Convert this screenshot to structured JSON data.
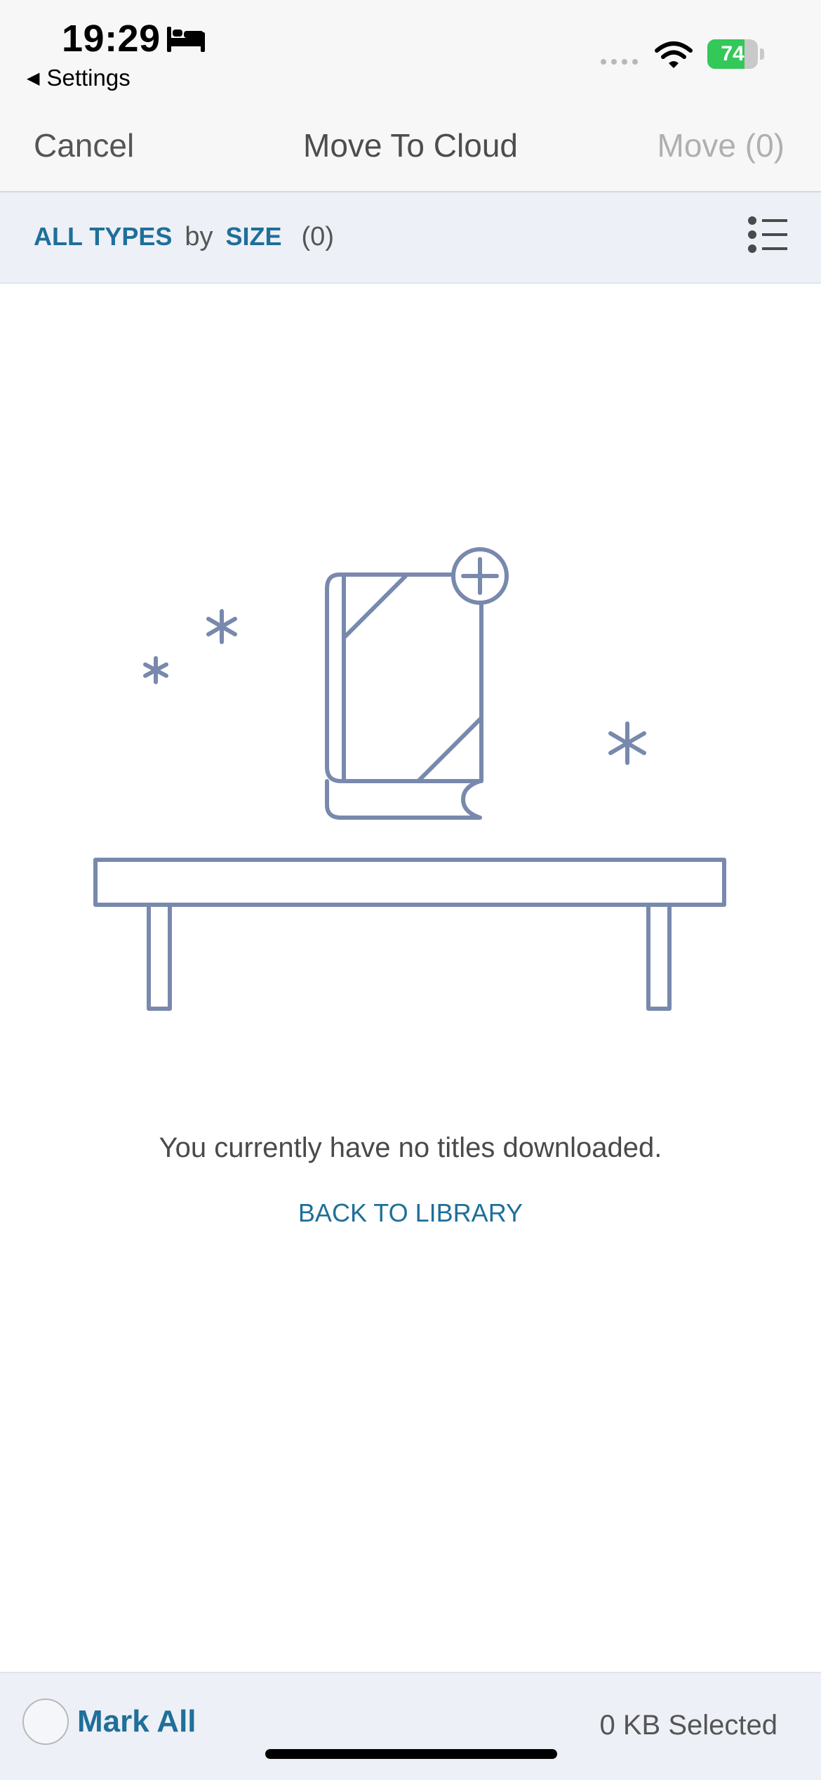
{
  "status_bar": {
    "time": "19:29",
    "back_label": "Settings",
    "battery_percent": 74,
    "battery_label": "74",
    "battery_color": "#34c759",
    "icons": [
      "bed-icon",
      "cellular-signal-icon",
      "wifi-icon",
      "battery-charging-icon"
    ]
  },
  "nav": {
    "cancel_label": "Cancel",
    "title": "Move To Cloud",
    "move_label": "Move (0)"
  },
  "filter": {
    "type_label": "ALL TYPES",
    "by_label": "by",
    "sort_label": "SIZE",
    "count_label": "(0)",
    "view_icon": "list-view-icon"
  },
  "empty_state": {
    "illustration": "empty-bookshelf-icon",
    "message": "You currently have no titles downloaded.",
    "action_label": "BACK TO LIBRARY"
  },
  "bottom_bar": {
    "mark_all_label": "Mark All",
    "selected_label": "0 KB Selected"
  },
  "colors": {
    "accent": "#1f6f99",
    "illustration": "#7889ad",
    "bar_background": "#edf0f6",
    "disabled": "#b0b0b0"
  }
}
